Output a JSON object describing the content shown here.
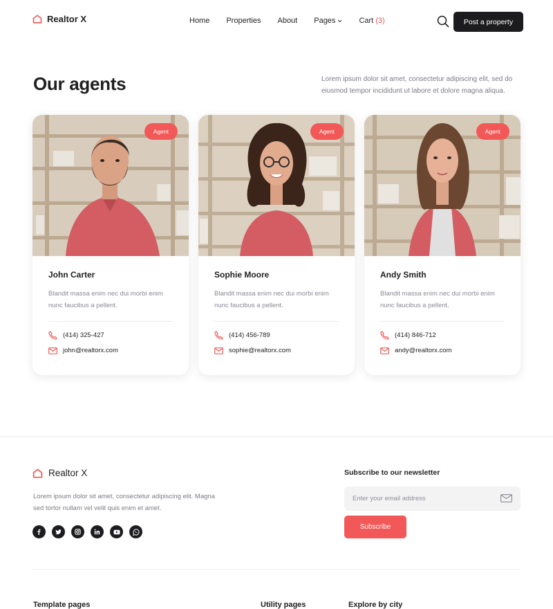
{
  "brand": {
    "name": "Realtor X",
    "accent": "#f25858",
    "dark": "#1c1c1e"
  },
  "nav": {
    "items": [
      "Home",
      "Properties",
      "About",
      "Pages",
      "Cart"
    ],
    "cart_count": "(3)",
    "search_icon": "search-icon",
    "post_button": "Post a property"
  },
  "hero": {
    "title": "Our agents",
    "intro": "Lorem ipsum dolor sit amet, consectetur adipiscing elit, sed do eiusmod tempor incididunt ut labore et dolore magna aliqua."
  },
  "agents": [
    {
      "badge": "Agent",
      "name": "John Carter",
      "desc": "Blandit massa enim nec dui morbi enim nunc faucibus a pellent.",
      "phone": "(414) 325-427",
      "email": "john@realtorx.com"
    },
    {
      "badge": "Agent",
      "name": "Sophie Moore",
      "desc": "Blandit massa enim nec dui morbi enim nunc faucibus a pellent.",
      "phone": "(414) 456-789",
      "email": "sophie@realtorx.com"
    },
    {
      "badge": "Agent",
      "name": "Andy Smith",
      "desc": "Blandit massa enim nec dui morbi enim nunc faucibus a pellent.",
      "phone": "(414) 846-712",
      "email": "andy@realtorx.com"
    }
  ],
  "footer": {
    "brand": "Realtor X",
    "desc": "Lorem ipsum dolor sit amet, consectetur adipiscing elit. Magna sed tortor nullam vel velit quis enim et amet.",
    "socials": [
      "facebook-icon",
      "twitter-icon",
      "instagram-icon",
      "linkedin-icon",
      "youtube-icon",
      "whatsapp-icon"
    ],
    "newsletter_title": "Subscribe to our newsletter",
    "email_placeholder": "Enter your email address",
    "subscribe_label": "Subscribe",
    "columns": [
      "Template pages",
      "Utility pages",
      "Explore by city"
    ]
  }
}
